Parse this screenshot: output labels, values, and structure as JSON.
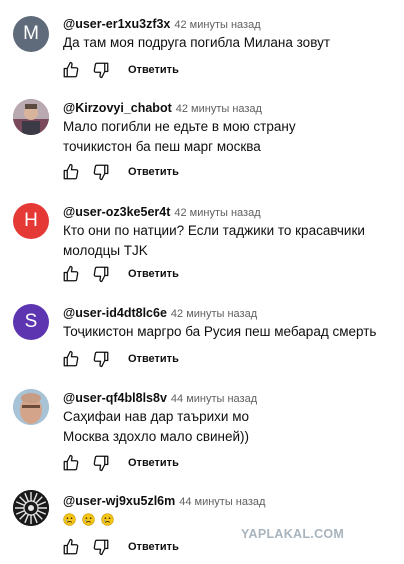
{
  "comments": [
    {
      "user": "@user-er1xu3zf3x",
      "time": "42 минуты назад",
      "avatar_letter": "M",
      "avatar_color": "#5f6b7a",
      "text": "Да там моя подруга погибла Милана зовут",
      "reply_label": "Ответить"
    },
    {
      "user": "@Kirzovyi_chabot",
      "time": "42 минуты назад",
      "avatar_letter": "",
      "avatar_color": "#8a7b86",
      "text": "Мало погибли не едьте в мою страну точикистон ба пеш марг москва",
      "reply_label": "Ответить"
    },
    {
      "user": "@user-oz3ke5er4t",
      "time": "42 минуты назад",
      "avatar_letter": "H",
      "avatar_color": "#e53935",
      "text": "Кто они по натции? Если таджики то красавчики молодцы TJK",
      "reply_label": "Ответить"
    },
    {
      "user": "@user-id4dt8lc6e",
      "time": "42 минуты назад",
      "avatar_letter": "S",
      "avatar_color": "#5e35b1",
      "text": "Тоҷикистон маргро ба Русия пеш мебарад смерть",
      "reply_label": "Ответить"
    },
    {
      "user": "@user-qf4bl8ls8v",
      "time": "44 минуты назад",
      "avatar_letter": "",
      "avatar_color": "#9db7c9",
      "text": "Саҳифаи нав дар таърихи мо Москва здохло мало свиней))",
      "reply_label": "Ответить"
    },
    {
      "user": "@user-wj9xu5zl6m",
      "time": "44 минуты назад",
      "avatar_letter": "",
      "avatar_color": "#111111",
      "text": "",
      "reply_label": "Ответить",
      "emoji": [
        "crying-face",
        "crying-face",
        "crying-face"
      ]
    }
  ],
  "watermark": "YAPLAKAL.COM",
  "colors": {
    "text": "#0f0f0f",
    "meta": "#606060",
    "watermark": "#a9b4bd",
    "emoji": "#f5c518"
  }
}
